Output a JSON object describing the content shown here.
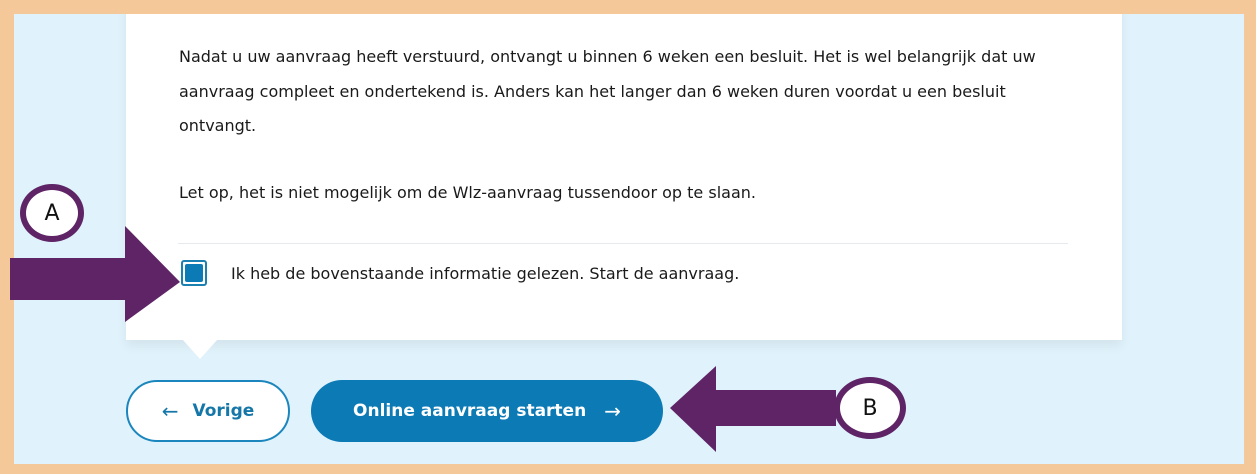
{
  "content": {
    "paragraph1": "Nadat u uw aanvraag heeft verstuurd, ontvangt u binnen 6 weken een besluit. Het is wel belangrijk dat uw aanvraag compleet en ondertekend is. Anders kan het langer dan 6 weken duren voordat u een besluit ontvangt.",
    "paragraph2": "Let op, het is niet mogelijk om de Wlz-aanvraag tussendoor op te slaan.",
    "checkbox_label": "Ik heb de bovenstaande informatie gelezen. Start de aanvraag.",
    "checkbox_checked": true
  },
  "buttons": {
    "prev_label": "Vorige",
    "prev_icon": "arrow-left-icon",
    "start_label": "Online aanvraag starten",
    "start_icon": "arrow-right-icon"
  },
  "annotations": {
    "a_label": "A",
    "b_label": "B"
  },
  "colors": {
    "border": "#f5c89a",
    "background": "#e0f2fb",
    "primary": "#0b7ab5",
    "annotation": "#5e2466"
  }
}
